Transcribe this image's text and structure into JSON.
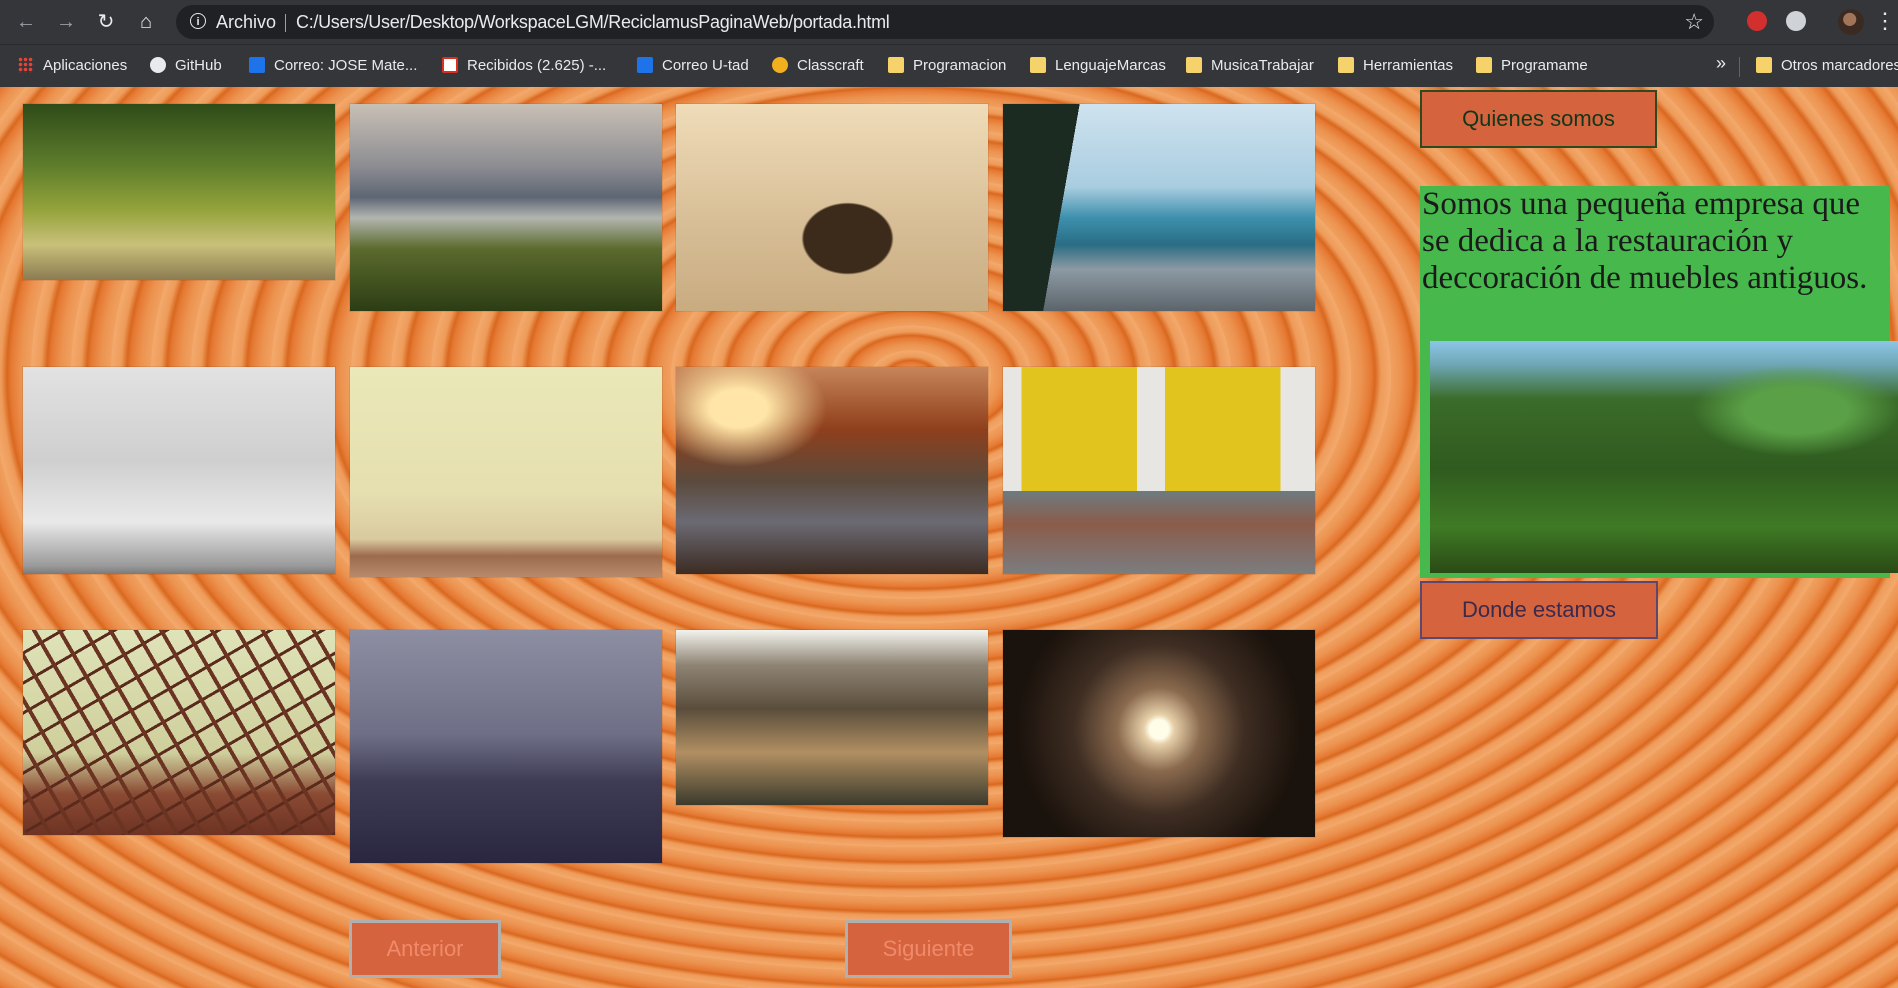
{
  "browser": {
    "scheme_label": "Archivo",
    "url": "C:/Users/User/Desktop/WorkspaceLGM/ReciclamusPaginaWeb/portada.html",
    "bookmarks": [
      {
        "label": "Aplicaciones",
        "icon": "apps-grid-icon"
      },
      {
        "label": "GitHub",
        "icon": "github-icon"
      },
      {
        "label": "Correo: JOSE Mate...",
        "icon": "outlook-icon"
      },
      {
        "label": "Recibidos (2.625) -...",
        "icon": "gmail-icon"
      },
      {
        "label": "Correo U-tad",
        "icon": "outlook-icon"
      },
      {
        "label": "Classcraft",
        "icon": "classcraft-icon"
      },
      {
        "label": "Programacion",
        "icon": "folder-icon"
      },
      {
        "label": "LenguajeMarcas",
        "icon": "folder-icon"
      },
      {
        "label": "MusicaTrabajar",
        "icon": "folder-icon"
      },
      {
        "label": "Herramientas",
        "icon": "folder-icon"
      },
      {
        "label": "Programame",
        "icon": "folder-icon"
      }
    ],
    "more_label": "»",
    "other_bookmarks": "Otros marcadores"
  },
  "gallery": {
    "photos": [
      "forest-moss-photo",
      "lake-mountains-photo",
      "couple-bench-photo",
      "rocky-beach-photo",
      "seagull-sky-photo",
      "foggy-pier-photo",
      "sunset-road-photo",
      "vintage-cars-photo",
      "bridge-structure-photo",
      "stormy-sea-photo",
      "rock-cliffs-photo",
      "tunnel-light-photo"
    ]
  },
  "sidebar": {
    "quienes_label": "Quienes somos",
    "about_text": "Somos una pequeña empresa que se dedica a la restauración y deccoración de muebles antiguos.",
    "donde_label": "Donde estamos"
  },
  "pagination": {
    "prev_label": "Anterior",
    "next_label": "Siguiente"
  }
}
